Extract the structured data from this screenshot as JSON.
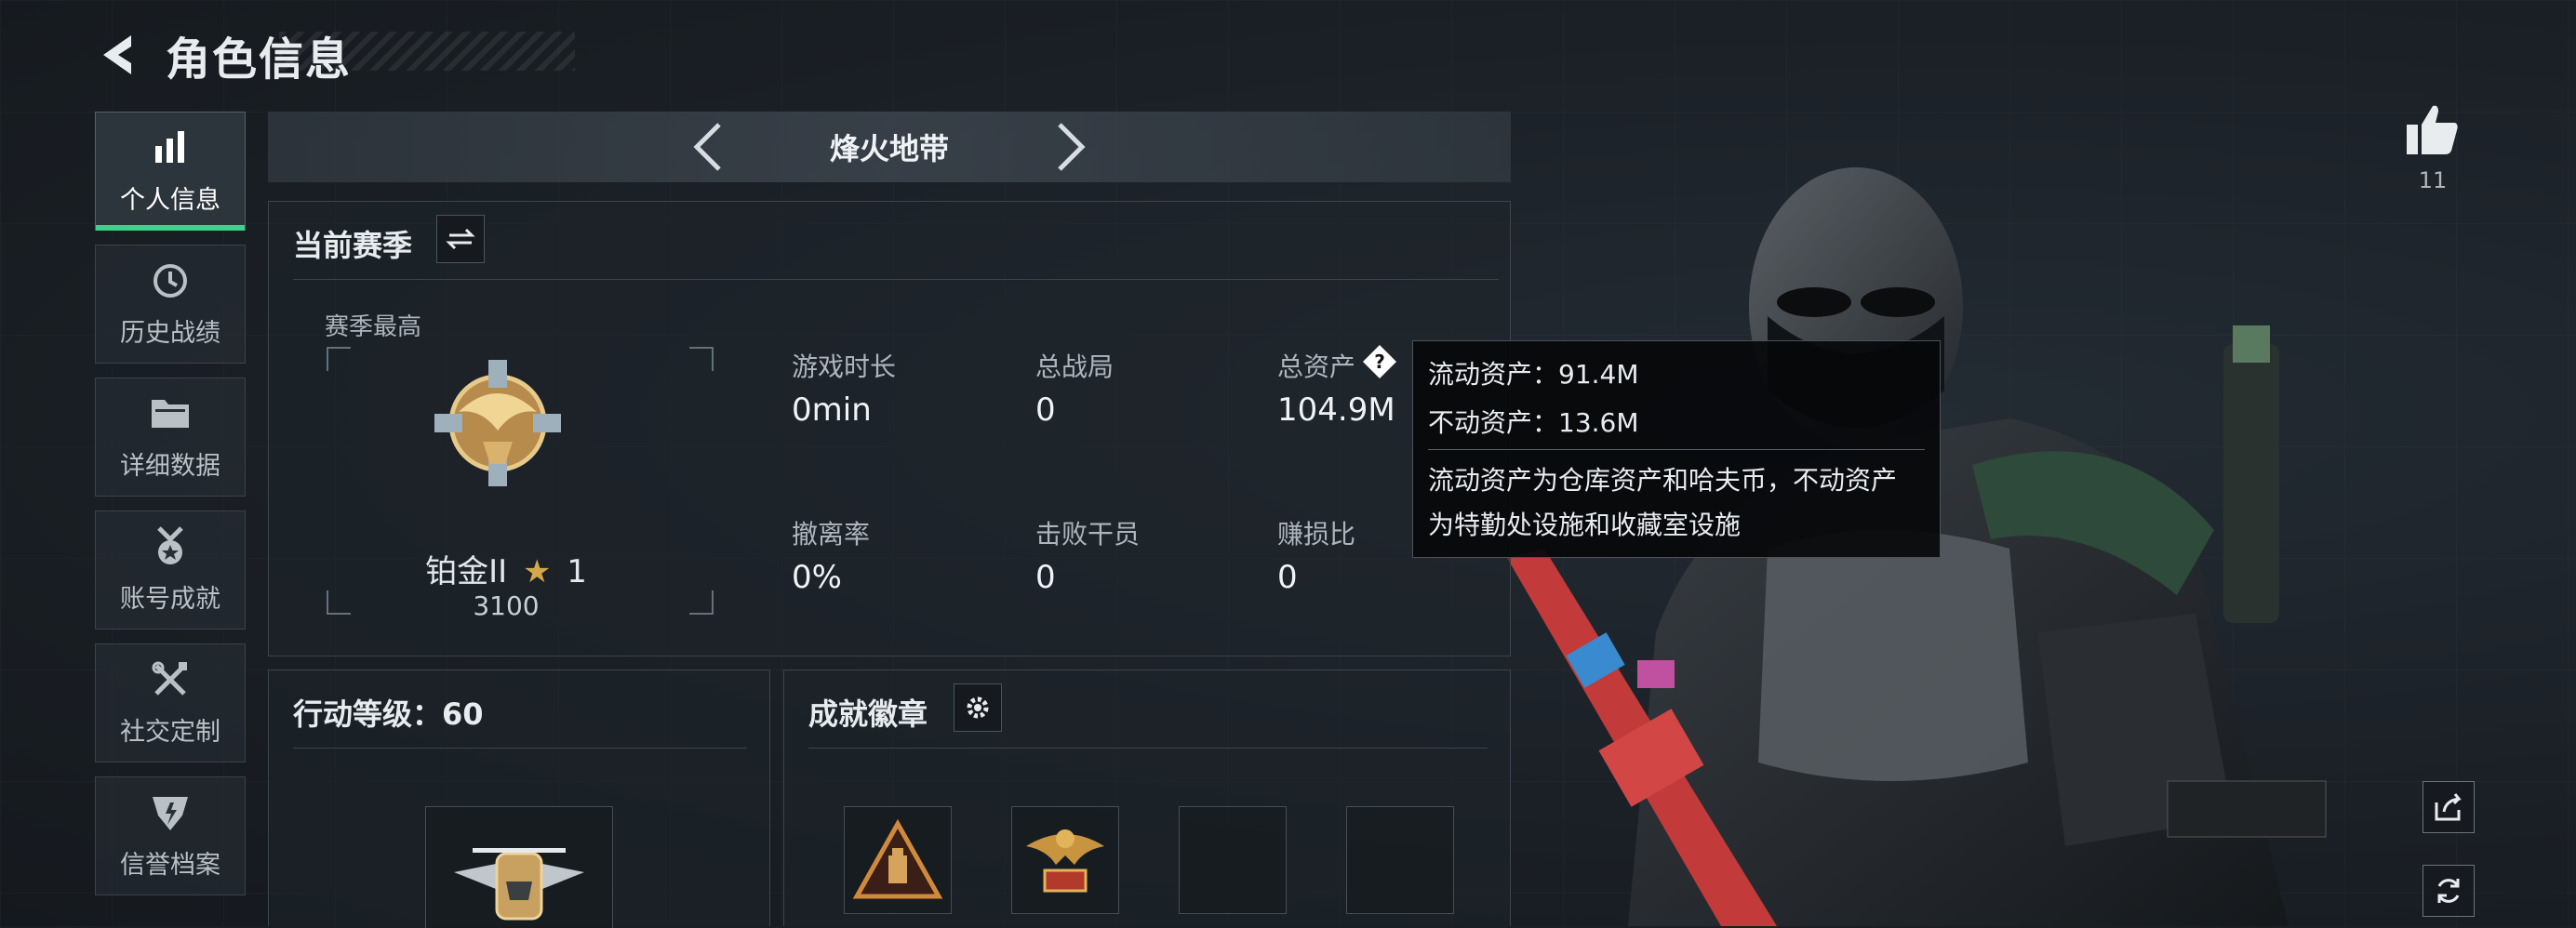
{
  "header": {
    "title": "角色信息"
  },
  "sidebar": {
    "items": [
      {
        "label": "个人信息",
        "icon": "bar-chart-icon"
      },
      {
        "label": "历史战绩",
        "icon": "history-clock-icon"
      },
      {
        "label": "详细数据",
        "icon": "folder-icon"
      },
      {
        "label": "账号成就",
        "icon": "medal-icon"
      },
      {
        "label": "社交定制",
        "icon": "tools-icon"
      },
      {
        "label": "信誉档案",
        "icon": "shield-icon"
      }
    ],
    "active_index": 0
  },
  "mode": {
    "label": "烽火地带"
  },
  "season": {
    "title": "当前赛季",
    "best_label": "赛季最高",
    "rank_name": "铂金II",
    "rank_star": "★",
    "rank_stars": "1",
    "rank_score": "3100",
    "stats": [
      {
        "label": "游戏时长",
        "value": "0min"
      },
      {
        "label": "总战局",
        "value": "0"
      },
      {
        "label": "总资产",
        "value": "104.9M"
      },
      {
        "label": "撤离率",
        "value": "0%"
      },
      {
        "label": "击败干员",
        "value": "0"
      },
      {
        "label": "赚损比",
        "value": "0"
      }
    ]
  },
  "tooltip": {
    "line1": "流动资产：91.4M",
    "line2": "不动资产：13.6M",
    "desc1": "流动资产为仓库资产和哈夫币，不动资产",
    "desc2": "为特勤处设施和收藏室设施"
  },
  "action_level": {
    "title": "行动等级：60"
  },
  "achievements": {
    "title": "成就徽章"
  },
  "likes": {
    "count": "11"
  },
  "colors": {
    "accent": "#3fd08a",
    "gold": "#c8a060",
    "background": "#1a1f25"
  }
}
